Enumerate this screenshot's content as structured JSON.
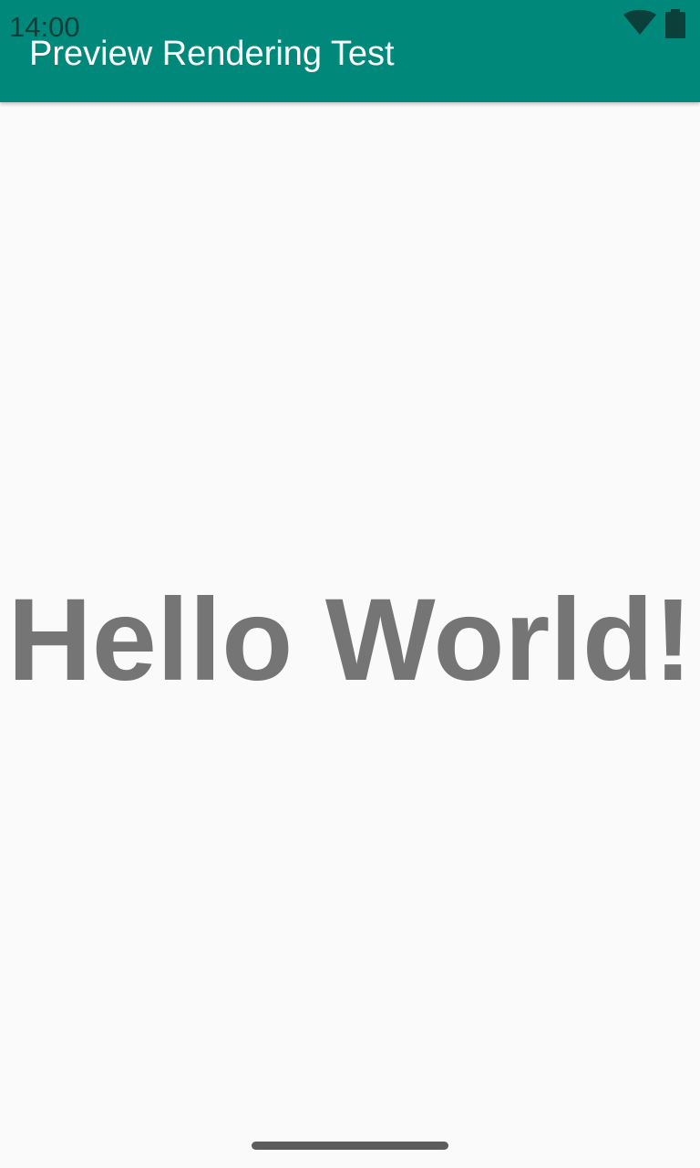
{
  "status_bar": {
    "time": "14:00",
    "icons": [
      "wifi-icon",
      "battery-icon"
    ]
  },
  "app_bar": {
    "title": "Preview Rendering Test",
    "color": "#00897b"
  },
  "content": {
    "text": "Hello World!",
    "text_color": "#757575",
    "background": "#fafafa"
  }
}
